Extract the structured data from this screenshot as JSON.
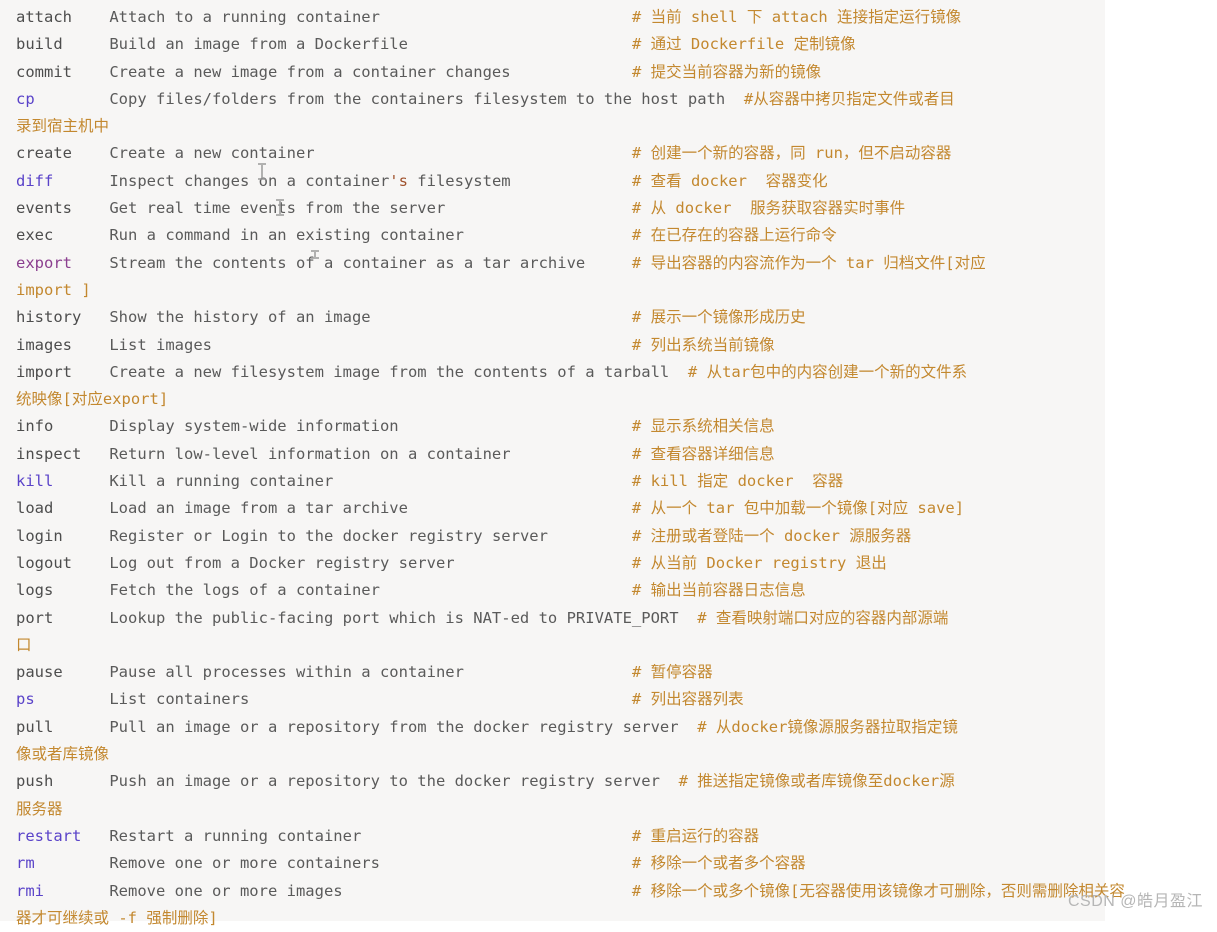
{
  "terminal": {
    "background": "#f7f6f5",
    "page_background": "#ffffff",
    "colors": {
      "default_text": "#4d4d4d",
      "command_blue": "#5a43c9",
      "command_purple": "#8b3f8f",
      "comment_orange": "#c3882f",
      "string_brown": "#a0522d",
      "watermark": "#b6b6b6"
    },
    "lines": [
      {
        "cmd": "attach",
        "cmd_color": "plain",
        "desc": "Attach to a running container",
        "comment": "# 当前 shell 下 attach 连接指定运行镜像"
      },
      {
        "cmd": "build",
        "cmd_color": "plain",
        "desc": "Build an image from a Dockerfile",
        "comment": "# 通过 Dockerfile 定制镜像"
      },
      {
        "cmd": "commit",
        "cmd_color": "plain",
        "desc": "Create a new image from a container changes",
        "comment": "# 提交当前容器为新的镜像"
      },
      {
        "cmd": "cp",
        "cmd_color": "blue",
        "desc": "Copy files/folders from the containers filesystem to the host path",
        "comment": "#从容器中拷贝指定文件或者目",
        "wrap": "录到宿主机中"
      },
      {
        "cmd": "create",
        "cmd_color": "plain",
        "desc": "Create a new container",
        "comment": "# 创建一个新的容器，同 run，但不启动容器"
      },
      {
        "cmd": "diff",
        "cmd_color": "blue",
        "desc": "Inspect changes on a container's filesystem",
        "comment": "# 查看 docker  容器变化"
      },
      {
        "cmd": "events",
        "cmd_color": "plain",
        "desc": "Get real time events from the server",
        "comment": "# 从 docker  服务获取容器实时事件"
      },
      {
        "cmd": "exec",
        "cmd_color": "plain",
        "desc": "Run a command in an existing container",
        "comment": "# 在已存在的容器上运行命令"
      },
      {
        "cmd": "export",
        "cmd_color": "purple",
        "desc": "Stream the contents of a container as a tar archive",
        "comment": "# 导出容器的内容流作为一个 tar 归档文件[对应",
        "wrap": "import ]"
      },
      {
        "cmd": "history",
        "cmd_color": "plain",
        "desc": "Show the history of an image",
        "comment": "# 展示一个镜像形成历史"
      },
      {
        "cmd": "images",
        "cmd_color": "plain",
        "desc": "List images",
        "comment": "# 列出系统当前镜像"
      },
      {
        "cmd": "import",
        "cmd_color": "plain",
        "desc": "Create a new filesystem image from the contents of a tarball",
        "comment": "# 从tar包中的内容创建一个新的文件系",
        "wrap": "统映像[对应export]"
      },
      {
        "cmd": "info",
        "cmd_color": "plain",
        "desc": "Display system-wide information",
        "comment": "# 显示系统相关信息"
      },
      {
        "cmd": "inspect",
        "cmd_color": "plain",
        "desc": "Return low-level information on a container",
        "comment": "# 查看容器详细信息"
      },
      {
        "cmd": "kill",
        "cmd_color": "blue",
        "desc": "Kill a running container",
        "comment": "# kill 指定 docker  容器"
      },
      {
        "cmd": "load",
        "cmd_color": "plain",
        "desc": "Load an image from a tar archive",
        "comment": "# 从一个 tar 包中加载一个镜像[对应 save]"
      },
      {
        "cmd": "login",
        "cmd_color": "plain",
        "desc": "Register or Login to the docker registry server",
        "comment": "# 注册或者登陆一个 docker 源服务器"
      },
      {
        "cmd": "logout",
        "cmd_color": "plain",
        "desc": "Log out from a Docker registry server",
        "comment": "# 从当前 Docker registry 退出"
      },
      {
        "cmd": "logs",
        "cmd_color": "plain",
        "desc": "Fetch the logs of a container",
        "comment": "# 输出当前容器日志信息"
      },
      {
        "cmd": "port",
        "cmd_color": "plain",
        "desc": "Lookup the public-facing port which is NAT-ed to PRIVATE_PORT",
        "comment": "# 查看映射端口对应的容器内部源端",
        "wrap": "口"
      },
      {
        "cmd": "pause",
        "cmd_color": "plain",
        "desc": "Pause all processes within a container",
        "comment": "# 暂停容器"
      },
      {
        "cmd": "ps",
        "cmd_color": "blue",
        "desc": "List containers",
        "comment": "# 列出容器列表"
      },
      {
        "cmd": "pull",
        "cmd_color": "plain",
        "desc": "Pull an image or a repository from the docker registry server",
        "comment": "# 从docker镜像源服务器拉取指定镜",
        "wrap": "像或者库镜像"
      },
      {
        "cmd": "push",
        "cmd_color": "plain",
        "desc": "Push an image or a repository to the docker registry server",
        "comment": "# 推送指定镜像或者库镜像至docker源",
        "wrap": "服务器"
      },
      {
        "cmd": "restart",
        "cmd_color": "blue",
        "desc": "Restart a running container",
        "comment": "# 重启运行的容器"
      },
      {
        "cmd": "rm",
        "cmd_color": "blue",
        "desc": "Remove one or more containers",
        "comment": "# 移除一个或者多个容器"
      },
      {
        "cmd": "rmi",
        "cmd_color": "blue",
        "desc": "Remove one or more images",
        "comment": "# 移除一个或多个镜像[无容器使用该镜像才可删除，否则需删除相关容",
        "wrap": "器才可继续或 -f 强制删除]"
      }
    ]
  },
  "watermark": {
    "text": "CSDN @皓月盈江"
  }
}
